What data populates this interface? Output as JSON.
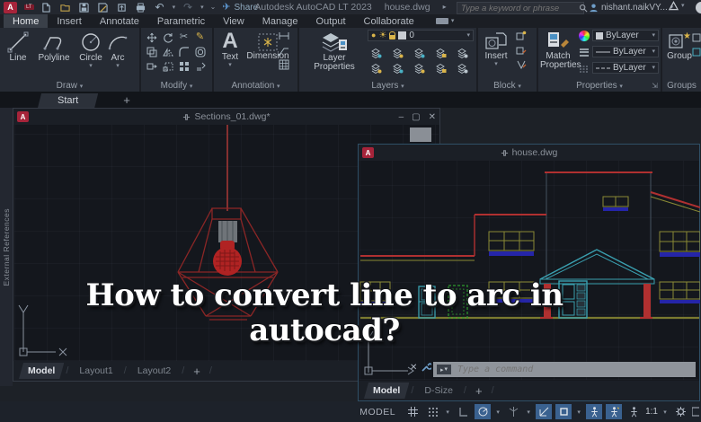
{
  "app": {
    "logo_letter": "A",
    "logo_badge": "LT"
  },
  "title_bar": {
    "share_label": "Share",
    "app_title": "Autodesk AutoCAD LT 2023",
    "doc_title": "house.dwg",
    "search_placeholder": "Type a keyword or phrase",
    "user_name": "nishant.naikVY..."
  },
  "ribbon": {
    "tabs": [
      "Home",
      "Insert",
      "Annotate",
      "Parametric",
      "View",
      "Manage",
      "Output",
      "Collaborate"
    ],
    "draw": {
      "label": "Draw",
      "line": "Line",
      "polyline": "Polyline",
      "circle": "Circle",
      "arc": "Arc"
    },
    "modify": {
      "label": "Modify"
    },
    "annotation": {
      "label": "Annotation",
      "text": "Text",
      "dimension": "Dimension"
    },
    "layers": {
      "label": "Layers",
      "big_button": "Layer Properties",
      "current_layer": "0"
    },
    "block": {
      "label": "Block",
      "insert": "Insert"
    },
    "properties": {
      "label": "Properties",
      "match": "Match Properties",
      "color_value": "ByLayer",
      "lineweight_value": "ByLayer",
      "linetype_value": "ByLayer"
    },
    "groups": {
      "label": "Groups",
      "group": "Group"
    }
  },
  "file_tabs": {
    "start": "Start",
    "add": "+"
  },
  "palette": {
    "label": "External References"
  },
  "sections_window": {
    "title": "Sections_01.dwg*",
    "tabs": [
      "Model",
      "Layout1",
      "Layout2"
    ],
    "add_tab": "+"
  },
  "house_window": {
    "title": "house.dwg",
    "tabs": [
      "Model",
      "D-Size"
    ],
    "add_tab": "+",
    "command_prompt": "Type a command"
  },
  "overlay": {
    "line1": "How to convert line to arc in",
    "line2": "autocad?"
  },
  "status_bar": {
    "model_label": "MODEL",
    "annotation_scale": "1:1"
  },
  "colors": {
    "accent_red": "#a6243a",
    "cad_red": "#b03030",
    "cad_olive": "#8a8a35",
    "cad_cyan": "#3aa0b0",
    "cad_green": "#2e9b2e",
    "sill_blue": "#2525a8",
    "highlight_blue": "#3a618f"
  }
}
